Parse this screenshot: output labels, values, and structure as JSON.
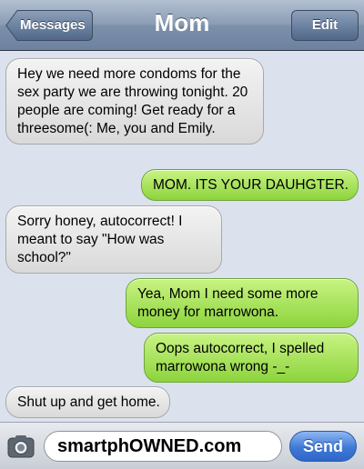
{
  "navbar": {
    "title": "Mom",
    "back_label": "Messages",
    "edit_label": "Edit"
  },
  "messages": [
    {
      "side": "in",
      "text": "Hey we need more condoms for the sex party we are throwing tonight. 20 people are coming! Get ready for a threesome(: Me, you and Emily."
    },
    {
      "side": "out",
      "text": "MOM. ITS YOUR DAUHGTER."
    },
    {
      "side": "in",
      "text": "Sorry honey, autocorrect! I meant to say \"How was school?\""
    },
    {
      "side": "out",
      "text": "Yea, Mom I need some more money for marrowona."
    },
    {
      "side": "out",
      "text": "Oops autocorrect, I spelled marrowona wrong -_-"
    },
    {
      "side": "in",
      "text": "Shut up and get home."
    }
  ],
  "composer": {
    "input_value": "smartphOWNED.com",
    "send_label": "Send",
    "camera_icon": "camera-icon"
  },
  "colors": {
    "incoming_bubble": "#e6e6e6",
    "outgoing_bubble": "#a6e05a",
    "navbar": "#7d90aa",
    "send_button": "#3f79d6"
  }
}
